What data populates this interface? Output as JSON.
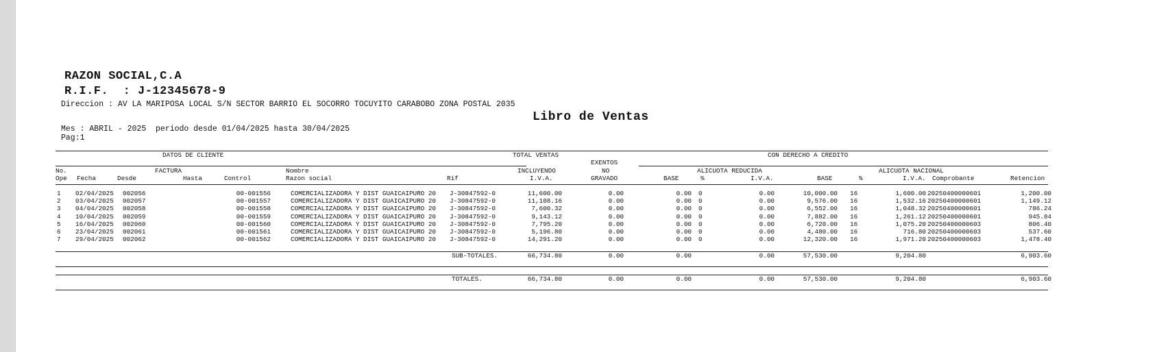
{
  "company": {
    "name": "RAZON SOCIAL,C.A",
    "rif": "R.I.F.  : J-12345678-9",
    "address": "Direccion : AV LA MARIPOSA LOCAL S/N SECTOR BARRIO EL SOCORRO TOCUYITO CARABOBO ZONA POSTAL 2035"
  },
  "report": {
    "title": "Libro de Ventas",
    "period": "Mes : ABRIL - 2025  periodo desde 01/04/2025 hasta 30/04/2025",
    "page": "Pag:1"
  },
  "headers": {
    "datos_cliente": "DATOS DE CLIENTE",
    "total_ventas": "TOTAL VENTAS",
    "con_derecho": "CON DERECHO A CREDITO",
    "exentos": "EXENTOS",
    "no": "NO",
    "gravado": "GRAVADO",
    "no_label": "No.",
    "ope": "Ope",
    "fecha": "Fecha",
    "factura": "FACTURA",
    "desde": "Desde",
    "hasta": "Hasta",
    "control": "Control",
    "nombre": "Nombre",
    "razon_social": "Razon social",
    "rif": "Rif",
    "incluyendo": "INCLUYENDO",
    "iva_total": "I.V.A.",
    "alicuota_reducida": "ALICUOTA REDUCIDA",
    "base_r": "BASE",
    "pct_r": "%",
    "iva_r": "I.V.A.",
    "alicuota_nacional": "ALICUOTA NACIONAL",
    "base_n": "BASE",
    "pct_n": "%",
    "iva_n": "I.V.A.",
    "comprobante": "Comprobante",
    "retencion": "Retencion"
  },
  "rows": [
    {
      "no": "1",
      "fecha": "02/04/2025",
      "desde": "002056",
      "control": "00-001556",
      "nombre": "COMERCIALIZADORA Y DIST GUAICAIPURO 20",
      "rif": "J-30847592-0",
      "total": "11,600.00",
      "exentos": "0.00",
      "base_r": "0.00",
      "pct_r": "0",
      "iva_r": "0.00",
      "base_n": "10,000.00",
      "pct_n": "16",
      "iva_n": "1,600.00",
      "comprobante": "20250400000601",
      "retencion": "1,200.00"
    },
    {
      "no": "2",
      "fecha": "03/04/2025",
      "desde": "002057",
      "control": "00-001557",
      "nombre": "COMERCIALIZADORA Y DIST GUAICAIPURO 20",
      "rif": "J-30847592-0",
      "total": "11,108.16",
      "exentos": "0.00",
      "base_r": "0.00",
      "pct_r": "0",
      "iva_r": "0.00",
      "base_n": "9,576.00",
      "pct_n": "16",
      "iva_n": "1,532.16",
      "comprobante": "20250400000601",
      "retencion": "1,149.12"
    },
    {
      "no": "3",
      "fecha": "04/04/2025",
      "desde": "002058",
      "control": "00-001558",
      "nombre": "COMERCIALIZADORA Y DIST GUAICAIPURO 20",
      "rif": "J-30847592-0",
      "total": "7,600.32",
      "exentos": "0.00",
      "base_r": "0.00",
      "pct_r": "0",
      "iva_r": "0.00",
      "base_n": "6,552.00",
      "pct_n": "16",
      "iva_n": "1,048.32",
      "comprobante": "20250400000601",
      "retencion": "786.24"
    },
    {
      "no": "4",
      "fecha": "10/04/2025",
      "desde": "002059",
      "control": "00-001559",
      "nombre": "COMERCIALIZADORA Y DIST GUAICAIPURO 20",
      "rif": "J-30847592-0",
      "total": "9,143.12",
      "exentos": "0.00",
      "base_r": "0.00",
      "pct_r": "0",
      "iva_r": "0.00",
      "base_n": "7,882.00",
      "pct_n": "16",
      "iva_n": "1,261.12",
      "comprobante": "20250400000601",
      "retencion": "945.84"
    },
    {
      "no": "5",
      "fecha": "16/04/2025",
      "desde": "002060",
      "control": "00-001560",
      "nombre": "COMERCIALIZADORA Y DIST GUAICAIPURO 20",
      "rif": "J-30847592-0",
      "total": "7,795.20",
      "exentos": "0.00",
      "base_r": "0.00",
      "pct_r": "0",
      "iva_r": "0.00",
      "base_n": "6,720.00",
      "pct_n": "16",
      "iva_n": "1,075.20",
      "comprobante": "20250400000603",
      "retencion": "806.40"
    },
    {
      "no": "6",
      "fecha": "23/04/2025",
      "desde": "002061",
      "control": "00-001561",
      "nombre": "COMERCIALIZADORA Y DIST GUAICAIPURO 20",
      "rif": "J-30847592-0",
      "total": "5,196.80",
      "exentos": "0.00",
      "base_r": "0.00",
      "pct_r": "0",
      "iva_r": "0.00",
      "base_n": "4,480.00",
      "pct_n": "16",
      "iva_n": "716.80",
      "comprobante": "20250400000603",
      "retencion": "537.60"
    },
    {
      "no": "7",
      "fecha": "29/04/2025",
      "desde": "002062",
      "control": "00-001562",
      "nombre": "COMERCIALIZADORA Y DIST GUAICAIPURO 20",
      "rif": "J-30847592-0",
      "total": "14,291.20",
      "exentos": "0.00",
      "base_r": "0.00",
      "pct_r": "0",
      "iva_r": "0.00",
      "base_n": "12,320.00",
      "pct_n": "16",
      "iva_n": "1,971.20",
      "comprobante": "20250400000603",
      "retencion": "1,478.40"
    }
  ],
  "subtotales": {
    "label": "SUB-TOTALES.",
    "total": "66,734.80",
    "exentos": "0.00",
    "base_r": "0.00",
    "iva_r": "0.00",
    "base_n": "57,530.00",
    "iva_n": "9,204.80",
    "retencion": "6,903.60"
  },
  "totales": {
    "label": "TOTALES.",
    "total": "66,734.80",
    "exentos": "0.00",
    "base_r": "0.00",
    "iva_r": "0.00",
    "base_n": "57,530.00",
    "iva_n": "9,204.80",
    "retencion": "6,903.60"
  }
}
